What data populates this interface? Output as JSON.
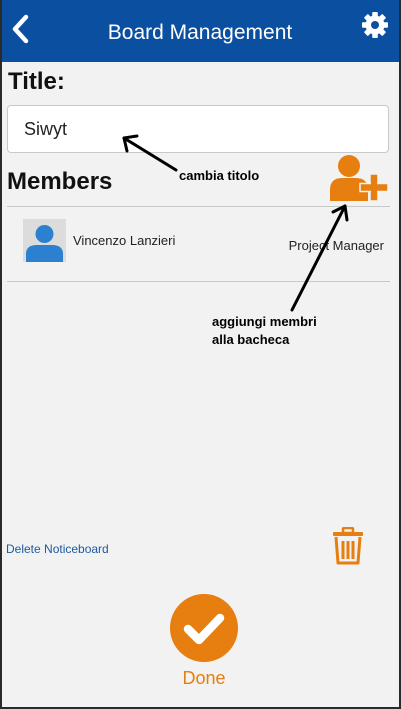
{
  "header": {
    "title": "Board Management",
    "back_icon": "chevron-left-icon",
    "settings_icon": "gear-icon",
    "background_color": "#0b4fa1"
  },
  "form": {
    "title_label": "Title:",
    "title_value": "Siwyt"
  },
  "members": {
    "heading": "Members",
    "add_icon": "add-user-icon",
    "items": [
      {
        "name": "Vincenzo Lanzieri",
        "role": "Project Manager",
        "avatar_icon": "user-avatar-icon"
      }
    ]
  },
  "annotations": {
    "change_title": "cambia titolo",
    "add_members_line1": "aggiungi membri",
    "add_members_line2": "alla bacheca"
  },
  "footer": {
    "delete_label": "Delete Noticeboard",
    "trash_icon": "trash-icon",
    "done_label": "Done",
    "done_icon": "checkmark-icon",
    "accent_color": "#e67e10"
  }
}
